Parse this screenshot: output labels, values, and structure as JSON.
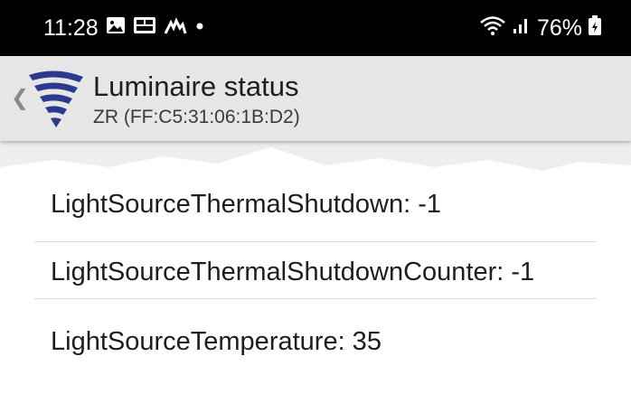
{
  "status_bar": {
    "time": "11:28",
    "battery_percent": "76%",
    "icons_left": [
      "image-icon",
      "media-icon",
      "lift-icon",
      "dot-icon"
    ],
    "icons_right": [
      "wifi-icon",
      "signal-icon",
      "battery-icon"
    ]
  },
  "app_bar": {
    "title": "Luminaire status",
    "subtitle": "ZR (FF:C5:31:06:1B:D2)",
    "brand_color": "#2b3a8f"
  },
  "items": [
    {
      "name": "LightSourceThermalShutdown",
      "value": "LightSourceThermalShutdown: -1"
    },
    {
      "name": "LightSourceThermalShutdownCounter",
      "value": "LightSourceThermalShutdownCounter: -1"
    },
    {
      "name": "LightSourceTemperature",
      "value": "LightSourceTemperature: 35"
    }
  ]
}
